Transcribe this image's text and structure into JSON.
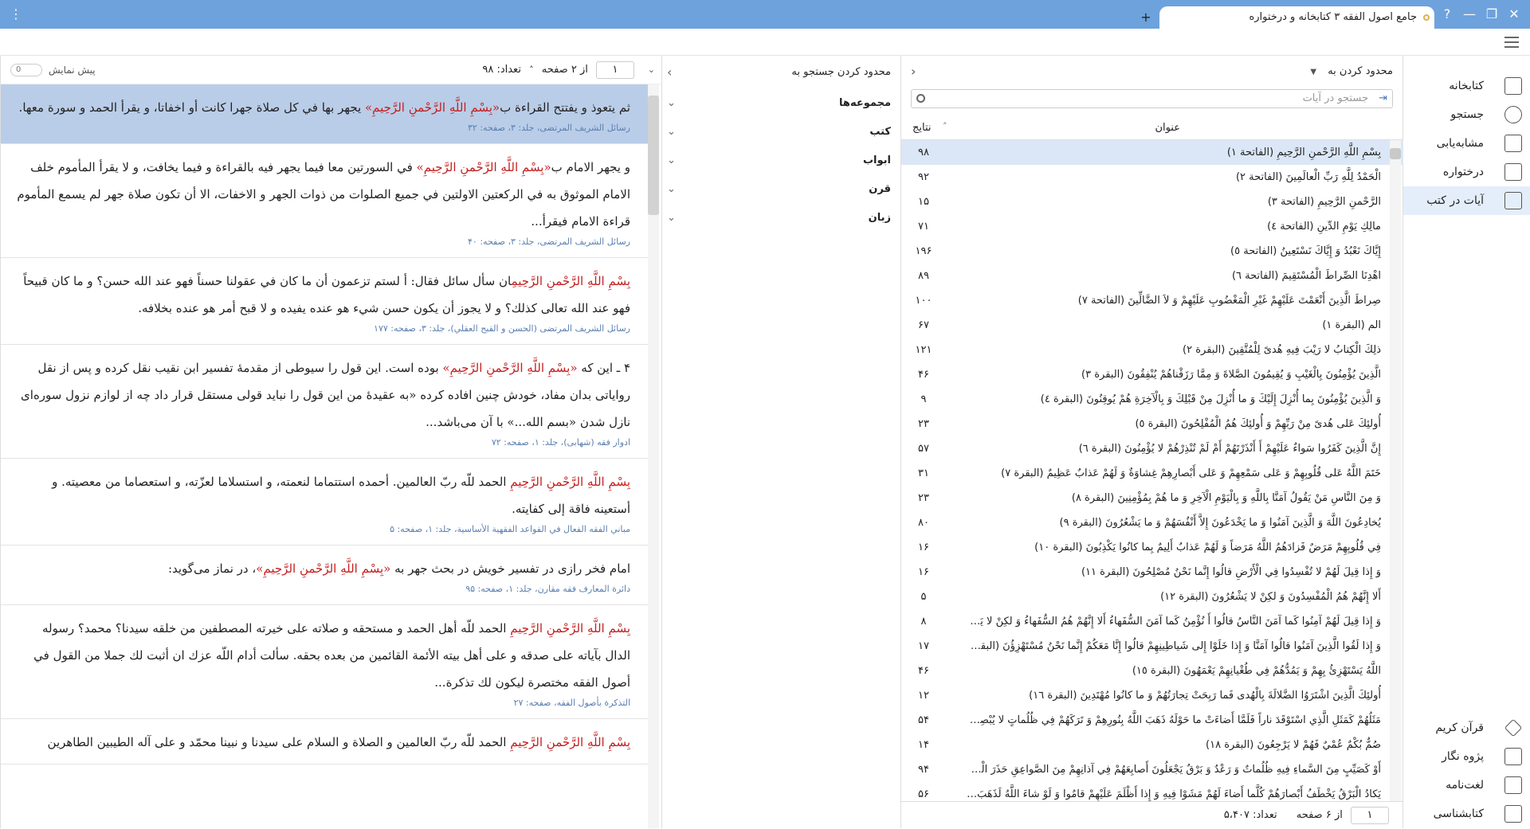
{
  "window": {
    "title": "جامع اصول الفقه ۳ کتابخانه و درختواره",
    "controls": {
      "close": "✕",
      "maximize": "❐",
      "minimize": "—",
      "help": "?"
    },
    "new_tab": "+",
    "menu": "⋮"
  },
  "nav": {
    "items": [
      {
        "label": "کتابخانه",
        "icon": "library-icon"
      },
      {
        "label": "جستجو",
        "icon": "search-icon"
      },
      {
        "label": "مشابه‌یابی",
        "icon": "similarity-icon"
      },
      {
        "label": "درختواره",
        "icon": "tree-icon"
      },
      {
        "label": "آیات در کتب",
        "icon": "verses-icon"
      }
    ],
    "bottom_items": [
      {
        "label": "قرآن کریم",
        "icon": "quran-icon"
      },
      {
        "label": "پژوه نگار",
        "icon": "notes-icon"
      },
      {
        "label": "لغت‌نامه",
        "icon": "dictionary-icon"
      },
      {
        "label": "کتابشناسی",
        "icon": "bibliography-icon"
      }
    ]
  },
  "results": {
    "limit_label": "محدود کردن به",
    "search_placeholder": "جستجو در آیات",
    "col_title": "عنوان",
    "col_count": "نتایج",
    "rows": [
      {
        "title": "بِسْمِ اللَّهِ الرَّحْمنِ الرَّحِيمِ (الفاتحة ١)",
        "count": "۹۸"
      },
      {
        "title": "الْحَمْدُ لِلَّهِ رَبِّ الْعالَمِينَ (الفاتحة ٢)",
        "count": "۹۲"
      },
      {
        "title": "الرَّحْمنِ الرَّحِيمِ (الفاتحة ٣)",
        "count": "۱۵"
      },
      {
        "title": "مالِكِ يَوْمِ الدِّينِ (الفاتحة ٤)",
        "count": "۷۱"
      },
      {
        "title": "إِيَّاكَ نَعْبُدُ وَ إِيَّاكَ نَسْتَعِينُ (الفاتحة ٥)",
        "count": "۱۹۶"
      },
      {
        "title": "اهْدِنَا الصِّراطَ الْمُسْتَقِيمَ (الفاتحة ٦)",
        "count": "۸۹"
      },
      {
        "title": "صِراطَ الَّذِينَ أَنْعَمْتَ عَلَيْهِمْ غَيْرِ الْمَغْضُوبِ عَلَيْهِمْ وَ لاَ الضَّالِّينَ (الفاتحة ٧)",
        "count": "۱۰۰"
      },
      {
        "title": "الم (البقرة ١)",
        "count": "۶۷"
      },
      {
        "title": "ذلِكَ الْكِتابُ لا رَيْبَ فِيهِ هُدىً لِلْمُتَّقِينَ (البقرة ٢)",
        "count": "۱۲۱"
      },
      {
        "title": "الَّذِينَ يُؤْمِنُونَ بِالْغَيْبِ وَ يُقِيمُونَ الصَّلاةَ وَ مِمَّا رَزَقْناهُمْ يُنْفِقُونَ (البقرة ٣)",
        "count": "۴۶"
      },
      {
        "title": "وَ الَّذِينَ يُؤْمِنُونَ بِما أُنْزِلَ إِلَيْكَ وَ ما أُنْزِلَ مِنْ قَبْلِكَ وَ بِالْآخِرَةِ هُمْ يُوقِنُونَ (البقرة ٤)",
        "count": "۹"
      },
      {
        "title": "أُولئِكَ عَلى هُدىً مِنْ رَبِّهِمْ وَ أُولئِكَ هُمُ الْمُفْلِحُونَ (البقرة ٥)",
        "count": "۲۳"
      },
      {
        "title": "إِنَّ الَّذِينَ كَفَرُوا سَواءٌ عَلَيْهِمْ أَ أَنْذَرْتَهُمْ أَمْ لَمْ تُنْذِرْهُمْ لا يُؤْمِنُونَ (البقرة ٦)",
        "count": "۵۷"
      },
      {
        "title": "خَتَمَ اللَّهُ عَلى قُلُوبِهِمْ وَ عَلى سَمْعِهِمْ وَ عَلى أَبْصارِهِمْ غِشاوَةٌ وَ لَهُمْ عَذابٌ عَظِيمٌ (البقرة ٧)",
        "count": "۳۱"
      },
      {
        "title": "وَ مِنَ النَّاسِ مَنْ يَقُولُ آمَنَّا بِاللَّهِ وَ بِالْيَوْمِ الْآخِرِ وَ ما هُمْ بِمُؤْمِنِينَ (البقرة ٨)",
        "count": "۲۳"
      },
      {
        "title": "يُخادِعُونَ اللَّهَ وَ الَّذِينَ آمَنُوا وَ ما يَخْدَعُونَ إِلاَّ أَنْفُسَهُمْ وَ ما يَشْعُرُونَ (البقرة ٩)",
        "count": "۸۰"
      },
      {
        "title": "فِي قُلُوبِهِمْ مَرَضٌ فَزادَهُمُ اللَّهُ مَرَضاً وَ لَهُمْ عَذابٌ أَلِيمٌ بِما كانُوا يَكْذِبُونَ (البقرة ١٠)",
        "count": "۱۶"
      },
      {
        "title": "وَ إِذا قِيلَ لَهُمْ لا تُفْسِدُوا فِي الْأَرْضِ قالُوا إِنَّما نَحْنُ مُصْلِحُونَ (البقرة ١١)",
        "count": "۱۶"
      },
      {
        "title": "أَلا إِنَّهُمْ هُمُ الْمُفْسِدُونَ وَ لكِنْ لا يَشْعُرُونَ (البقرة ١٢)",
        "count": "۵"
      },
      {
        "title": "وَ إِذا قِيلَ لَهُمْ آمِنُوا كَما آمَنَ النَّاسُ قالُوا أَ نُؤْمِنُ كَما آمَنَ السُّفَهاءُ أَلا إِنَّهُمْ هُمُ السُّفَهاءُ وَ لكِنْ لا يَعْلَمُ...",
        "count": "۸"
      },
      {
        "title": "وَ إِذا لَقُوا الَّذِينَ آمَنُوا قالُوا آمَنَّا وَ إِذا خَلَوْا إِلى شَياطِينِهِمْ قالُوا إِنَّا مَعَكُمْ إِنَّما نَحْنُ مُسْتَهْزِؤُنَ (البقرة ١٤)",
        "count": "۱۷"
      },
      {
        "title": "اللَّهُ يَسْتَهْزِئُ بِهِمْ وَ يَمُدُّهُمْ فِي طُغْيانِهِمْ يَعْمَهُونَ (البقرة ١٥)",
        "count": "۴۶"
      },
      {
        "title": "أُولئِكَ الَّذِينَ اشْتَرَوُا الضَّلالَةَ بِالْهُدى فَما رَبِحَتْ تِجارَتُهُمْ وَ ما كانُوا مُهْتَدِينَ (البقرة ١٦)",
        "count": "۱۲"
      },
      {
        "title": "مَثَلُهُمْ كَمَثَلِ الَّذِي اسْتَوْقَدَ ناراً فَلَمَّا أَضاءَتْ ما حَوْلَهُ ذَهَبَ اللَّهُ بِنُورِهِمْ وَ تَرَكَهُمْ فِي ظُلُماتٍ لا يُبْصِرُ...",
        "count": "۵۴"
      },
      {
        "title": "صُمٌّ بُكْمٌ عُمْيٌ فَهُمْ لا يَرْجِعُونَ (البقرة ١٨)",
        "count": "۱۴"
      },
      {
        "title": "أَوْ كَصَيِّبٍ مِنَ السَّماءِ فِيهِ ظُلُماتٌ وَ رَعْدٌ وَ بَرْقٌ يَجْعَلُونَ أَصابِعَهُمْ فِي آذانِهِمْ مِنَ الصَّواعِقِ حَذَرَ الْمَوْ...",
        "count": "۹۴"
      },
      {
        "title": "يَكادُ الْبَرْقُ يَخْطَفُ أَبْصارَهُمْ كُلَّما أَضاءَ لَهُمْ مَشَوْا فِيهِ وَ إِذا أَظْلَمَ عَلَيْهِمْ قامُوا وَ لَوْ شاءَ اللَّهُ لَذَهَبَ بِ...",
        "count": "۵۶"
      }
    ],
    "footer": {
      "page": "۱",
      "of_pages": "از ۶ صفحه",
      "count": "تعداد: ۵،۴۰۷"
    }
  },
  "filters": {
    "title": "محدود کردن جستجو به",
    "items": [
      "مجموعه‌ها",
      "کتب",
      "ابواب",
      "قرن",
      "زبان"
    ]
  },
  "texts": {
    "header": {
      "page": "۱",
      "of_pages": "از ۲ صفحه",
      "count": "تعداد: ۹۸",
      "preview": "پیش نمایش",
      "preview_value": "0"
    },
    "entries": [
      {
        "pre": "ثم يتعوذ و يفتتح القراءة ب",
        "hl": "«بِسْمِ اللَّهِ الرَّحْمنِ الرَّحِيمِ»",
        "post": " يجهر بها في كل صلاة جهرا كانت أو اخفاتا، و يقرأ الحمد و سورة معها.",
        "src": "رسائل الشريف المرتضى، جلد: ۳، صفحه: ۳۲"
      },
      {
        "pre": "و يجهر الامام ب",
        "hl": "«بِسْمِ اللَّهِ الرَّحْمنِ الرَّحِيمِ»",
        "post": " في السورتين معا فيما يجهر فيه بالقراءة و فيما يخافت، و لا يقرأ المأموم خلف الامام الموثوق به في الركعتين الاولتين في جميع الصلوات من ذوات الجهر و الاخفات، الا أن تكون صلاة جهر لم يسمع المأموم قراءة الامام فيقرأ...",
        "src": "رسائل الشريف المرتضى، جلد: ۳، صفحه: ۴۰"
      },
      {
        "pre": "",
        "hl": "بِسْمِ اللَّهِ الرَّحْمنِ الرَّحِيمِ",
        "post": "ان سأل سائل فقال: أ لستم تزعمون أن ما كان في عقولنا حسناً فهو عند الله حسن؟ و ما كان قبيحاً فهو عند الله تعالى كذلك؟ و لا يجوز أن يكون حسن شيء هو عنده يفيده و لا قبح أمر هو عنده بخلافه.",
        "src": "رسائل الشريف المرتضى (الحسن و القبح العقلي)، جلد: ۳، صفحه: ۱۷۷"
      },
      {
        "pre": "۴ ـ این که ",
        "hl": "«بِسْمِ اللَّهِ الرَّحْمنِ الرَّحِيمِ»",
        "post": " بوده است. این قول را سیوطی از مقدمهٔ تفسیر ابن نقیب نقل کرده و پس از نقل روایاتی بدان مفاد، خودش چنین افاده کرده «به عقیدهٔ من این قول را نباید قولی مستقل قرار داد چه از لوازم نزول سوره‌ای نازل شدن «بسم الله...» با آن می‌باشد...",
        "src": "ادوار فقه (شهابی)، جلد: ۱، صفحه: ۷۲"
      },
      {
        "pre": "",
        "hl": "بِسْمِ اللَّهِ الرَّحْمنِ الرَّحِيمِ",
        "post": " الحمد للّه ربّ العالمين. أحمده استتماما لنعمته، و استسلاما لعزّته، و استعصاما من معصيته. و أستعينه فاقة إلى كفايته.",
        "src": "مباني الفقه الفعال في القواعد الفقهية الأساسية، جلد: ۱، صفحه: ۵"
      },
      {
        "pre": "امام فخر رازی در تفسیر خویش در بحث جهر به ",
        "hl": "«بِسْمِ اللَّهِ الرَّحْمنِ الرَّحِيمِ»",
        "post": "، در نماز می‌گوید:",
        "src": "دائرة المعارف فقه مقارن، جلد: ۱، صفحه: ۹۵"
      },
      {
        "pre": "",
        "hl": "بِسْمِ اللَّهِ الرَّحْمنِ الرَّحِيمِ",
        "post": " الحمد للّه أهل الحمد و مستحقه و صلاته على خيرته المصطفين من خلقه سيدنا؟ محمد؟ رسوله الدال بآياته على صدقه و على أهل بيته الأئمة القائمين من بعده بحقه. سألت أدام اللّه عزك ان أثبت لك جملا من القول في أصول الفقه مختصرة ليكون لك تذكرة...",
        "src": "التذكرة بأصول الفقه، صفحه: ۲۷"
      },
      {
        "pre": "",
        "hl": "بِسْمِ اللَّهِ الرَّحْمنِ الرَّحِيمِ",
        "post": " الحمد للّه ربّ العالمين و الصلاة و السلام على سيدنا و نبينا محمّد و على آله الطيبين الطاهرين",
        "src": ""
      }
    ]
  }
}
